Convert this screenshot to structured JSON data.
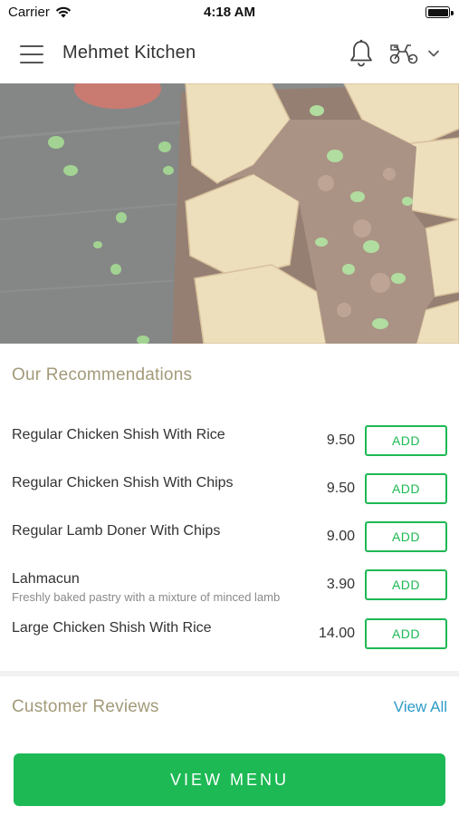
{
  "status_bar": {
    "carrier": "Carrier",
    "time": "4:18 AM"
  },
  "header": {
    "title": "Mehmet Kitchen",
    "icons": [
      "menu-icon",
      "bell-icon",
      "delivery-rider-icon",
      "chevron-down-icon"
    ]
  },
  "recommendations": {
    "title": "Our Recommendations",
    "items": [
      {
        "name": "Regular Chicken Shish With Rice",
        "description": "",
        "price": "9.50",
        "button": "ADD"
      },
      {
        "name": "Regular Chicken Shish With Chips",
        "description": "",
        "price": "9.50",
        "button": "ADD"
      },
      {
        "name": "Regular Lamb Doner With Chips",
        "description": "",
        "price": "9.00",
        "button": "ADD"
      },
      {
        "name": "Lahmacun",
        "description": "Freshly baked pastry with a mixture of minced lamb",
        "price": "3.90",
        "button": "ADD"
      },
      {
        "name": "Large Chicken Shish With Rice",
        "description": "",
        "price": "14.00",
        "button": "ADD"
      }
    ]
  },
  "reviews": {
    "title": "Customer Reviews",
    "view_all": "View All"
  },
  "footer": {
    "view_menu": "VIEW MENU"
  },
  "colors": {
    "accent_green": "#1db954",
    "section_title": "#a39a7a",
    "link_blue": "#2d9cc8"
  }
}
